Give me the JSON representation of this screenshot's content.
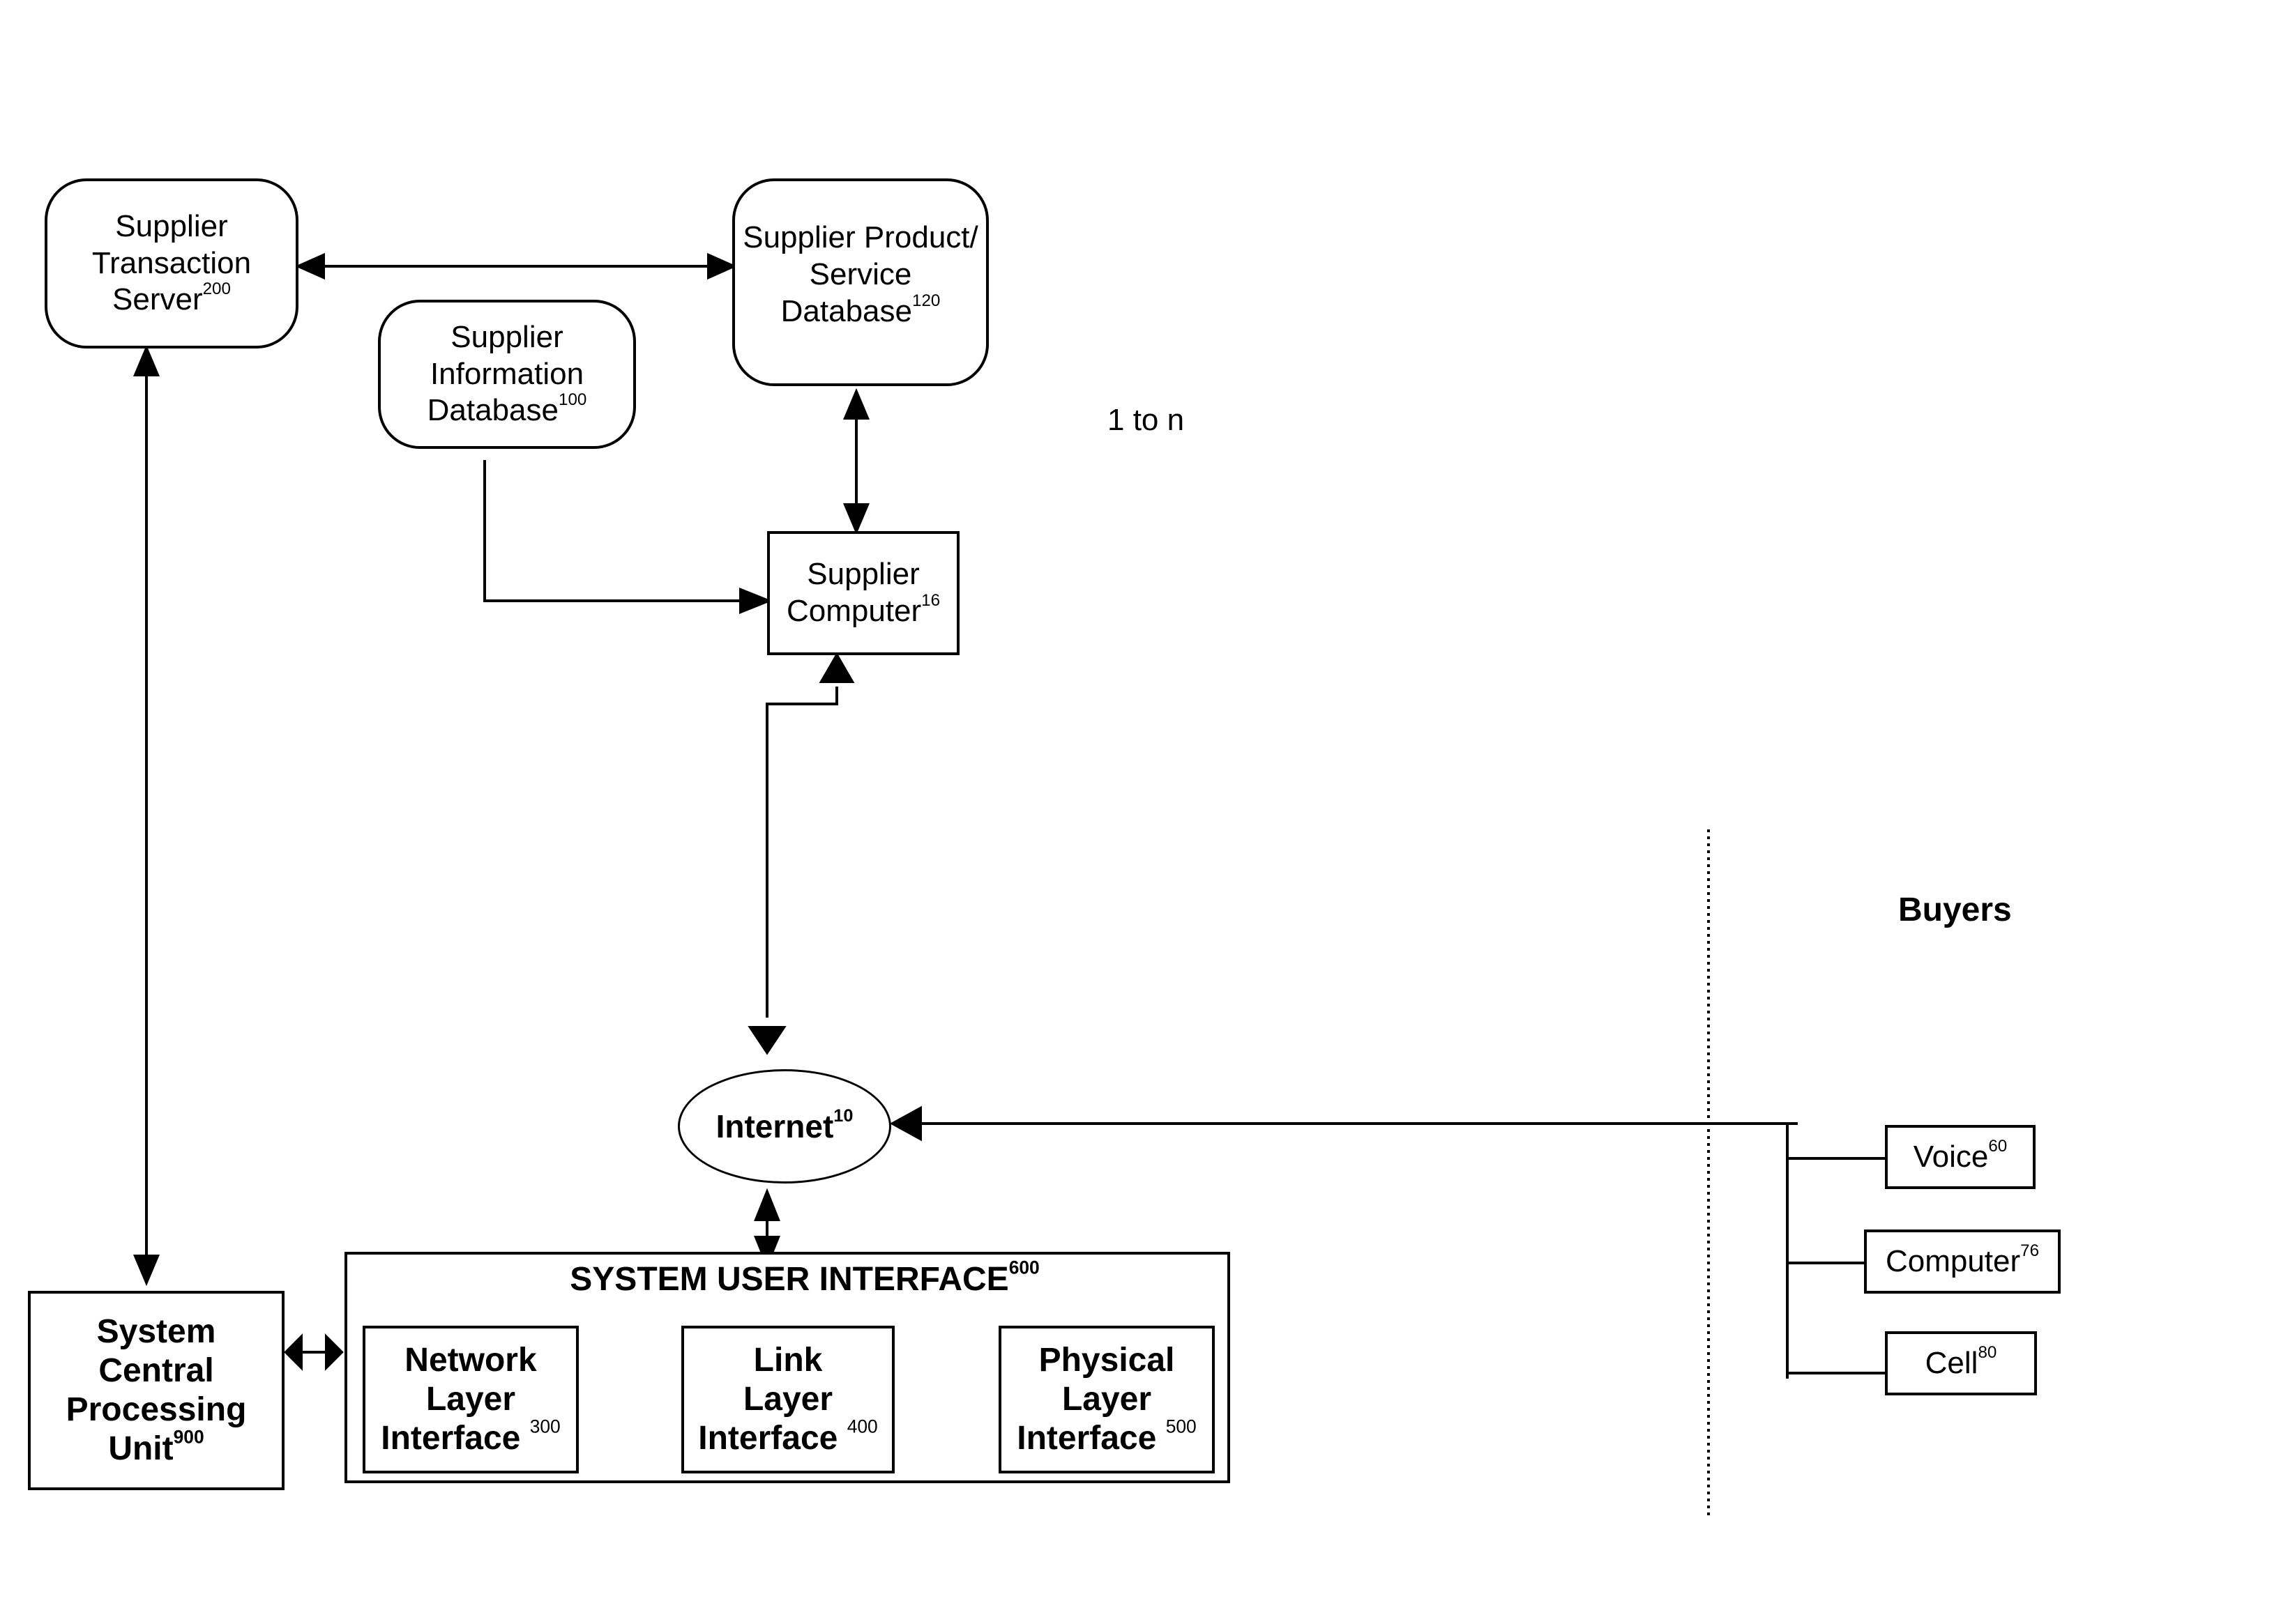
{
  "nodes": {
    "transaction_server": {
      "l1": "Supplier",
      "l2": "Transaction",
      "l3": "Server",
      "ref": "200"
    },
    "product_db": {
      "l1": "Supplier Product/",
      "l2": "Service",
      "l3": "Database",
      "ref": "120"
    },
    "info_db": {
      "l1": "Supplier",
      "l2": "Information",
      "l3": "Database",
      "ref": "100"
    },
    "supplier_computer": {
      "l1": "Supplier",
      "l2": "Computer",
      "ref": "16"
    },
    "internet": {
      "l1": "Internet",
      "ref": "10"
    },
    "cpu": {
      "l1": "System",
      "l2": "Central",
      "l3": "Processing",
      "l4": "Unit",
      "ref": "900"
    },
    "sui": {
      "title": "SYSTEM USER INTERFACE",
      "ref": "600"
    },
    "network_layer": {
      "l1": "Network",
      "l2": "Layer",
      "l3": "Interface",
      "ref": "300"
    },
    "link_layer": {
      "l1": "Link",
      "l2": "Layer",
      "l3": "Interface",
      "ref": "400"
    },
    "physical_layer": {
      "l1": "Physical",
      "l2": "Layer",
      "l3": "Interface",
      "ref": "500"
    },
    "voice": {
      "l1": "Voice",
      "ref": "60"
    },
    "computer": {
      "l1": "Computer",
      "ref": "76"
    },
    "cell": {
      "l1": "Cell",
      "ref": "80"
    }
  },
  "labels": {
    "multiplicity": "1 to n",
    "buyers": "Buyers"
  }
}
